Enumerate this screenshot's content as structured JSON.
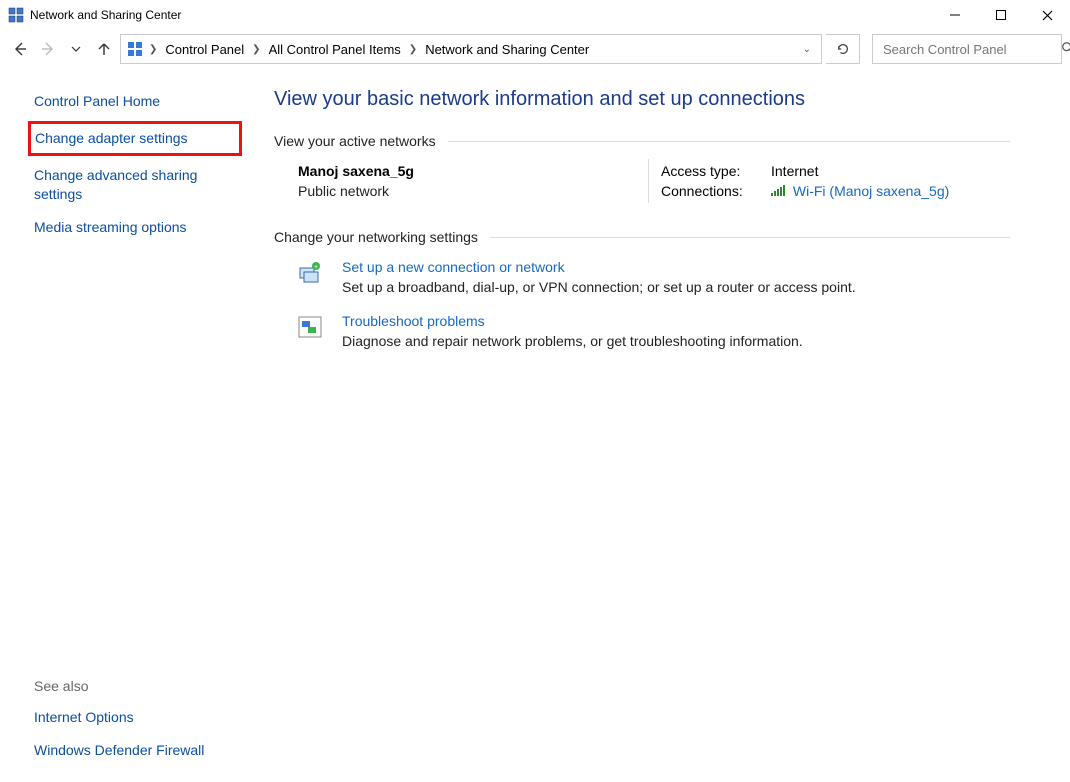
{
  "window": {
    "title": "Network and Sharing Center"
  },
  "breadcrumb": {
    "items": [
      "Control Panel",
      "All Control Panel Items",
      "Network and Sharing Center"
    ]
  },
  "search": {
    "placeholder": "Search Control Panel"
  },
  "sidebar": {
    "links": {
      "home": "Control Panel Home",
      "adapter": "Change adapter settings",
      "advanced": "Change advanced sharing settings",
      "media": "Media streaming options"
    },
    "seealso_head": "See also",
    "seealso": {
      "inet": "Internet Options",
      "fw": "Windows Defender Firewall"
    }
  },
  "main": {
    "title": "View your basic network information and set up connections",
    "section_active": "View your active networks",
    "network": {
      "name": "Manoj saxena_5g",
      "type": "Public network",
      "access_label": "Access type:",
      "access_value": "Internet",
      "conn_label": "Connections:",
      "conn_value": "Wi-Fi (Manoj saxena_5g)"
    },
    "section_change": "Change your networking settings",
    "opt1": {
      "title": "Set up a new connection or network",
      "desc": "Set up a broadband, dial-up, or VPN connection; or set up a router or access point."
    },
    "opt2": {
      "title": "Troubleshoot problems",
      "desc": "Diagnose and repair network problems, or get troubleshooting information."
    }
  }
}
